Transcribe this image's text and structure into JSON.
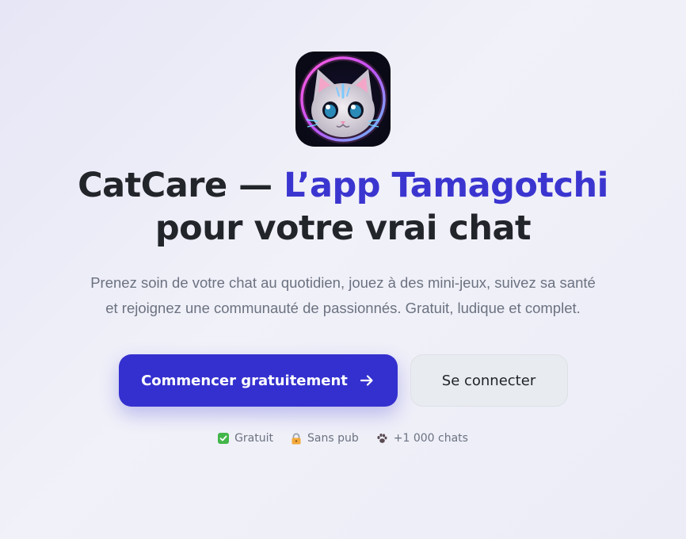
{
  "app": {
    "logo_icon": "cat-face-neon-icon"
  },
  "hero": {
    "title_part1": "CatCare — ",
    "title_accent": "L’app Tamagotchi",
    "title_part2": "pour votre vrai chat",
    "subtitle": "Prenez soin de votre chat au quotidien, jouez à des mini-jeux, suivez sa santé et rejoignez une communauté de passionnés. Gratuit, ludique et complet."
  },
  "actions": {
    "primary_label": "Commencer gratuitement",
    "primary_icon": "arrow-right-icon",
    "secondary_label": "Se connecter"
  },
  "badges": [
    {
      "icon": "check-icon",
      "label": "Gratuit"
    },
    {
      "icon": "lock-icon",
      "label": "Sans pub"
    },
    {
      "icon": "paw-icon",
      "label": "+1 000 chats"
    }
  ],
  "colors": {
    "accent": "#3b35d0",
    "primary_button": "#3430cf",
    "secondary_button": "#e8ebef",
    "text_dark": "#22252a",
    "text_muted": "#6b7280"
  }
}
